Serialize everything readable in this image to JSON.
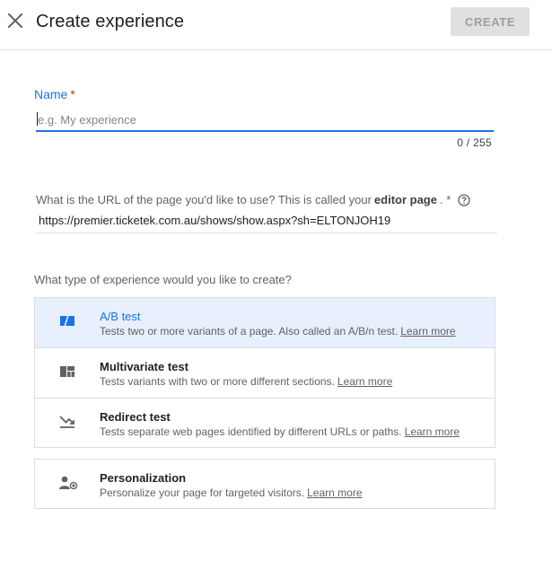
{
  "header": {
    "close_icon": "close-icon",
    "title": "Create experience",
    "create_label": "CREATE"
  },
  "name_field": {
    "label": "Name",
    "required_mark": "*",
    "placeholder": "e.g. My experience",
    "value": "",
    "counter": "0 / 255"
  },
  "url_field": {
    "label_prefix": "What is the URL of the page you'd like to use? This is called your",
    "label_bold": "editor page",
    "label_suffix": ". *",
    "help_icon": "help-circle-icon",
    "value": "https://premier.ticketek.com.au/shows/show.aspx?sh=ELTONJOH19"
  },
  "experience_type": {
    "question": "What type of experience would you like to create?",
    "options": [
      {
        "icon": "ab-test-icon",
        "title": "A/B test",
        "description": "Tests two or more variants of a page. Also called an A/B/n test.",
        "link": "Learn more",
        "selected": true
      },
      {
        "icon": "multivariate-icon",
        "title": "Multivariate test",
        "description": "Tests variants with two or more different sections.",
        "link": "Learn more",
        "selected": false
      },
      {
        "icon": "redirect-icon",
        "title": "Redirect test",
        "description": "Tests separate web pages identified by different URLs or paths.",
        "link": "Learn more",
        "selected": false
      },
      {
        "icon": "personalization-icon",
        "title": "Personalization",
        "description": "Personalize your page for targeted visitors.",
        "link": "Learn more",
        "selected": false
      }
    ]
  },
  "colors": {
    "accent": "#1a73e8",
    "required": "#d93025",
    "selected_bg": "#e8f0fe",
    "disabled_button_bg": "#e0e0e0"
  }
}
